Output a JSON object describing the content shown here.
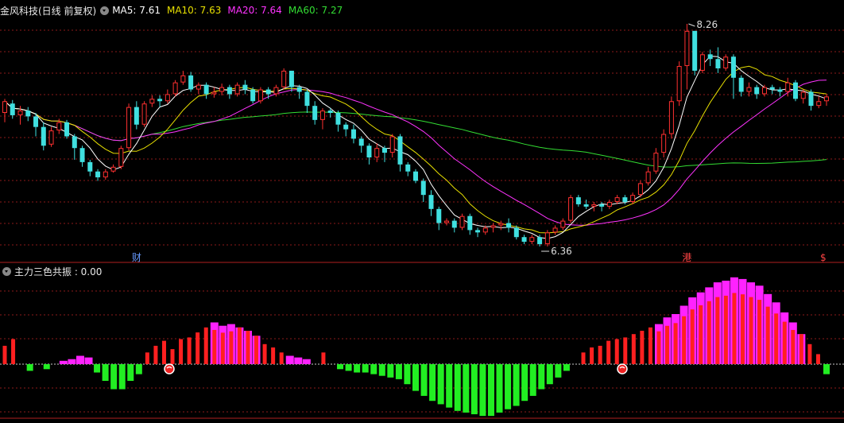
{
  "main_header": {
    "title": "金风科技(日线 前复权)",
    "ma5_label": "MA5: 7.61",
    "ma10_label": "MA10: 7.63",
    "ma20_label": "MA20: 7.64",
    "ma60_label": "MA60: 7.27",
    "ma5_color": "#ffffff",
    "ma10_color": "#e8e000",
    "ma20_color": "#ff33ff",
    "ma60_color": "#33dd33"
  },
  "indicator_header": {
    "title": "主力三色共振 : 0.00"
  },
  "markers": {
    "high_label": "8.26",
    "low_label": "6.36",
    "cai": "财",
    "gang": "港",
    "dollar": "$"
  },
  "colors": {
    "up": "#ff3030",
    "down": "#40e0e0",
    "bar_red": "#ff2020",
    "bar_green": "#22ee22",
    "bar_magenta": "#ff22ff",
    "grid": "#8b1a1a"
  },
  "chart_data": {
    "type": "candlestick",
    "price_axis_visible": false,
    "candles": [
      [
        7.5,
        7.6,
        7.42,
        7.62
      ],
      [
        7.58,
        7.48,
        7.45,
        7.61
      ],
      [
        7.48,
        7.52,
        7.4,
        7.56
      ],
      [
        7.52,
        7.47,
        7.43,
        7.55
      ],
      [
        7.47,
        7.38,
        7.3,
        7.5
      ],
      [
        7.38,
        7.22,
        7.18,
        7.42
      ],
      [
        7.23,
        7.35,
        7.21,
        7.38
      ],
      [
        7.35,
        7.42,
        7.32,
        7.45
      ],
      [
        7.42,
        7.3,
        7.28,
        7.44
      ],
      [
        7.3,
        7.2,
        7.1,
        7.32
      ],
      [
        7.2,
        7.08,
        7.04,
        7.22
      ],
      [
        7.08,
        7.0,
        6.96,
        7.1
      ],
      [
        7.0,
        6.95,
        6.92,
        7.02
      ],
      [
        6.95,
        7.0,
        6.93,
        7.02
      ],
      [
        7.0,
        7.04,
        6.99,
        7.06
      ],
      [
        7.04,
        7.2,
        7.02,
        7.22
      ],
      [
        7.2,
        7.55,
        7.18,
        7.58
      ],
      [
        7.55,
        7.4,
        7.36,
        7.6
      ],
      [
        7.4,
        7.58,
        7.38,
        7.6
      ],
      [
        7.58,
        7.62,
        7.55,
        7.65
      ],
      [
        7.62,
        7.6,
        7.55,
        7.65
      ],
      [
        7.6,
        7.66,
        7.58,
        7.7
      ],
      [
        7.66,
        7.76,
        7.64,
        7.78
      ],
      [
        7.76,
        7.82,
        7.74,
        7.86
      ],
      [
        7.82,
        7.7,
        7.68,
        7.85
      ],
      [
        7.7,
        7.74,
        7.66,
        7.76
      ],
      [
        7.74,
        7.66,
        7.62,
        7.76
      ],
      [
        7.66,
        7.68,
        7.63,
        7.72
      ],
      [
        7.68,
        7.72,
        7.65,
        7.75
      ],
      [
        7.72,
        7.66,
        7.62,
        7.74
      ],
      [
        7.66,
        7.74,
        7.64,
        7.76
      ],
      [
        7.74,
        7.7,
        7.66,
        7.78
      ],
      [
        7.7,
        7.6,
        7.58,
        7.72
      ],
      [
        7.6,
        7.7,
        7.58,
        7.72
      ],
      [
        7.7,
        7.66,
        7.62,
        7.72
      ],
      [
        7.66,
        7.72,
        7.64,
        7.74
      ],
      [
        7.72,
        7.86,
        7.7,
        7.88
      ],
      [
        7.86,
        7.72,
        7.68,
        7.86
      ],
      [
        7.72,
        7.68,
        7.62,
        7.74
      ],
      [
        7.68,
        7.56,
        7.5,
        7.7
      ],
      [
        7.56,
        7.44,
        7.4,
        7.6
      ],
      [
        7.44,
        7.52,
        7.36,
        7.54
      ],
      [
        7.52,
        7.5,
        7.46,
        7.54
      ],
      [
        7.5,
        7.4,
        7.34,
        7.52
      ],
      [
        7.4,
        7.36,
        7.3,
        7.42
      ],
      [
        7.36,
        7.28,
        7.24,
        7.4
      ],
      [
        7.28,
        7.22,
        7.16,
        7.3
      ],
      [
        7.22,
        7.12,
        7.06,
        7.24
      ],
      [
        7.12,
        7.2,
        7.08,
        7.24
      ],
      [
        7.2,
        7.16,
        7.08,
        7.22
      ],
      [
        7.16,
        7.3,
        7.12,
        7.32
      ],
      [
        7.3,
        7.06,
        7.0,
        7.32
      ],
      [
        7.06,
        7.0,
        6.96,
        7.08
      ],
      [
        7.0,
        6.92,
        6.9,
        7.02
      ],
      [
        6.92,
        6.8,
        6.74,
        6.94
      ],
      [
        6.8,
        6.68,
        6.62,
        6.84
      ],
      [
        6.68,
        6.56,
        6.5,
        6.7
      ],
      [
        6.56,
        6.58,
        6.54,
        6.6
      ],
      [
        6.58,
        6.52,
        6.48,
        6.6
      ],
      [
        6.52,
        6.62,
        6.5,
        6.64
      ],
      [
        6.62,
        6.5,
        6.46,
        6.64
      ],
      [
        6.5,
        6.48,
        6.44,
        6.52
      ],
      [
        6.48,
        6.52,
        6.46,
        6.54
      ],
      [
        6.52,
        6.54,
        6.48,
        6.56
      ],
      [
        6.54,
        6.56,
        6.5,
        6.58
      ],
      [
        6.56,
        6.52,
        6.48,
        6.6
      ],
      [
        6.52,
        6.44,
        6.42,
        6.54
      ],
      [
        6.44,
        6.4,
        6.38,
        6.46
      ],
      [
        6.4,
        6.44,
        6.38,
        6.46
      ],
      [
        6.44,
        6.38,
        6.36,
        6.46
      ],
      [
        6.38,
        6.48,
        6.36,
        6.5
      ],
      [
        6.48,
        6.52,
        6.46,
        6.54
      ],
      [
        6.52,
        6.58,
        6.5,
        6.6
      ],
      [
        6.58,
        6.78,
        6.56,
        6.8
      ],
      [
        6.78,
        6.72,
        6.7,
        6.8
      ],
      [
        6.72,
        6.7,
        6.68,
        6.76
      ],
      [
        6.7,
        6.72,
        6.66,
        6.74
      ],
      [
        6.72,
        6.7,
        6.66,
        6.74
      ],
      [
        6.7,
        6.74,
        6.68,
        6.76
      ],
      [
        6.74,
        6.78,
        6.72,
        6.8
      ],
      [
        6.78,
        6.74,
        6.72,
        6.8
      ],
      [
        6.74,
        6.8,
        6.72,
        6.82
      ],
      [
        6.8,
        6.9,
        6.78,
        6.92
      ],
      [
        6.9,
        7.0,
        6.88,
        7.04
      ],
      [
        7.0,
        7.16,
        6.98,
        7.2
      ],
      [
        7.16,
        7.32,
        7.12,
        7.36
      ],
      [
        7.32,
        7.6,
        7.28,
        7.64
      ],
      [
        7.6,
        7.9,
        7.56,
        7.94
      ],
      [
        7.9,
        8.2,
        7.7,
        8.26
      ],
      [
        8.2,
        7.86,
        7.82,
        8.2
      ],
      [
        7.86,
        8.0,
        7.84,
        8.02
      ],
      [
        8.0,
        7.96,
        7.9,
        8.04
      ],
      [
        7.96,
        7.88,
        7.84,
        8.06
      ],
      [
        7.88,
        7.98,
        7.86,
        8.0
      ],
      [
        7.98,
        7.8,
        7.62,
        8.0
      ],
      [
        7.8,
        7.68,
        7.64,
        7.82
      ],
      [
        7.68,
        7.72,
        7.64,
        7.76
      ],
      [
        7.72,
        7.66,
        7.62,
        7.74
      ],
      [
        7.66,
        7.72,
        7.64,
        7.74
      ],
      [
        7.72,
        7.7,
        7.66,
        7.74
      ],
      [
        7.7,
        7.68,
        7.64,
        7.72
      ],
      [
        7.68,
        7.76,
        7.64,
        7.8
      ],
      [
        7.76,
        7.62,
        7.6,
        7.78
      ],
      [
        7.62,
        7.68,
        7.58,
        7.7
      ],
      [
        7.68,
        7.56,
        7.52,
        7.7
      ],
      [
        7.56,
        7.6,
        7.54,
        7.64
      ],
      [
        7.6,
        7.64,
        7.56,
        7.66
      ]
    ],
    "indicator": [
      22,
      30,
      0,
      -8,
      0,
      -6,
      0,
      4,
      6,
      10,
      8,
      -10,
      -20,
      -30,
      -30,
      -20,
      -12,
      14,
      22,
      28,
      18,
      30,
      32,
      38,
      44,
      50,
      46,
      48,
      44,
      40,
      34,
      24,
      20,
      14,
      10,
      8,
      6,
      0,
      14,
      0,
      -6,
      -8,
      -10,
      -10,
      -12,
      -14,
      -16,
      -18,
      -24,
      -32,
      -38,
      -44,
      -48,
      -52,
      -56,
      -58,
      -60,
      -62,
      -62,
      -58,
      -54,
      -50,
      -44,
      -38,
      -30,
      -24,
      -16,
      -8,
      0,
      14,
      20,
      22,
      28,
      30,
      32,
      36,
      40,
      44,
      48,
      56,
      60,
      70,
      80,
      86,
      92,
      98,
      100,
      104,
      102,
      98,
      94,
      84,
      74,
      62,
      50,
      36,
      24,
      12,
      -12
    ]
  }
}
